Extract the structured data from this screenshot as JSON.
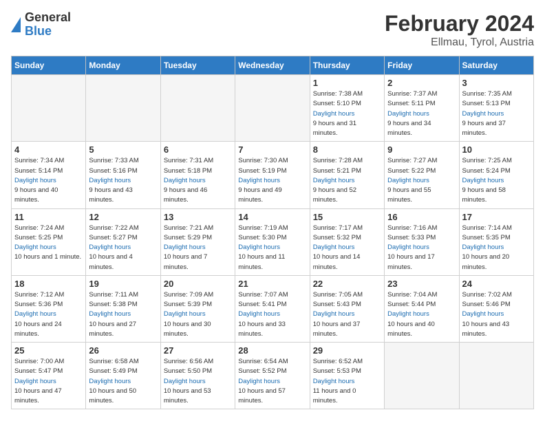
{
  "header": {
    "logo_general": "General",
    "logo_blue": "Blue",
    "month": "February 2024",
    "location": "Ellmau, Tyrol, Austria"
  },
  "days_of_week": [
    "Sunday",
    "Monday",
    "Tuesday",
    "Wednesday",
    "Thursday",
    "Friday",
    "Saturday"
  ],
  "weeks": [
    [
      {
        "day": "",
        "empty": true
      },
      {
        "day": "",
        "empty": true
      },
      {
        "day": "",
        "empty": true
      },
      {
        "day": "",
        "empty": true
      },
      {
        "day": "1",
        "sunrise": "7:38 AM",
        "sunset": "5:10 PM",
        "daylight": "9 hours and 31 minutes."
      },
      {
        "day": "2",
        "sunrise": "7:37 AM",
        "sunset": "5:11 PM",
        "daylight": "9 hours and 34 minutes."
      },
      {
        "day": "3",
        "sunrise": "7:35 AM",
        "sunset": "5:13 PM",
        "daylight": "9 hours and 37 minutes."
      }
    ],
    [
      {
        "day": "4",
        "sunrise": "7:34 AM",
        "sunset": "5:14 PM",
        "daylight": "9 hours and 40 minutes."
      },
      {
        "day": "5",
        "sunrise": "7:33 AM",
        "sunset": "5:16 PM",
        "daylight": "9 hours and 43 minutes."
      },
      {
        "day": "6",
        "sunrise": "7:31 AM",
        "sunset": "5:18 PM",
        "daylight": "9 hours and 46 minutes."
      },
      {
        "day": "7",
        "sunrise": "7:30 AM",
        "sunset": "5:19 PM",
        "daylight": "9 hours and 49 minutes."
      },
      {
        "day": "8",
        "sunrise": "7:28 AM",
        "sunset": "5:21 PM",
        "daylight": "9 hours and 52 minutes."
      },
      {
        "day": "9",
        "sunrise": "7:27 AM",
        "sunset": "5:22 PM",
        "daylight": "9 hours and 55 minutes."
      },
      {
        "day": "10",
        "sunrise": "7:25 AM",
        "sunset": "5:24 PM",
        "daylight": "9 hours and 58 minutes."
      }
    ],
    [
      {
        "day": "11",
        "sunrise": "7:24 AM",
        "sunset": "5:25 PM",
        "daylight": "10 hours and 1 minute."
      },
      {
        "day": "12",
        "sunrise": "7:22 AM",
        "sunset": "5:27 PM",
        "daylight": "10 hours and 4 minutes."
      },
      {
        "day": "13",
        "sunrise": "7:21 AM",
        "sunset": "5:29 PM",
        "daylight": "10 hours and 7 minutes."
      },
      {
        "day": "14",
        "sunrise": "7:19 AM",
        "sunset": "5:30 PM",
        "daylight": "10 hours and 11 minutes."
      },
      {
        "day": "15",
        "sunrise": "7:17 AM",
        "sunset": "5:32 PM",
        "daylight": "10 hours and 14 minutes."
      },
      {
        "day": "16",
        "sunrise": "7:16 AM",
        "sunset": "5:33 PM",
        "daylight": "10 hours and 17 minutes."
      },
      {
        "day": "17",
        "sunrise": "7:14 AM",
        "sunset": "5:35 PM",
        "daylight": "10 hours and 20 minutes."
      }
    ],
    [
      {
        "day": "18",
        "sunrise": "7:12 AM",
        "sunset": "5:36 PM",
        "daylight": "10 hours and 24 minutes."
      },
      {
        "day": "19",
        "sunrise": "7:11 AM",
        "sunset": "5:38 PM",
        "daylight": "10 hours and 27 minutes."
      },
      {
        "day": "20",
        "sunrise": "7:09 AM",
        "sunset": "5:39 PM",
        "daylight": "10 hours and 30 minutes."
      },
      {
        "day": "21",
        "sunrise": "7:07 AM",
        "sunset": "5:41 PM",
        "daylight": "10 hours and 33 minutes."
      },
      {
        "day": "22",
        "sunrise": "7:05 AM",
        "sunset": "5:43 PM",
        "daylight": "10 hours and 37 minutes."
      },
      {
        "day": "23",
        "sunrise": "7:04 AM",
        "sunset": "5:44 PM",
        "daylight": "10 hours and 40 minutes."
      },
      {
        "day": "24",
        "sunrise": "7:02 AM",
        "sunset": "5:46 PM",
        "daylight": "10 hours and 43 minutes."
      }
    ],
    [
      {
        "day": "25",
        "sunrise": "7:00 AM",
        "sunset": "5:47 PM",
        "daylight": "10 hours and 47 minutes."
      },
      {
        "day": "26",
        "sunrise": "6:58 AM",
        "sunset": "5:49 PM",
        "daylight": "10 hours and 50 minutes."
      },
      {
        "day": "27",
        "sunrise": "6:56 AM",
        "sunset": "5:50 PM",
        "daylight": "10 hours and 53 minutes."
      },
      {
        "day": "28",
        "sunrise": "6:54 AM",
        "sunset": "5:52 PM",
        "daylight": "10 hours and 57 minutes."
      },
      {
        "day": "29",
        "sunrise": "6:52 AM",
        "sunset": "5:53 PM",
        "daylight": "11 hours and 0 minutes."
      },
      {
        "day": "",
        "empty": true
      },
      {
        "day": "",
        "empty": true
      }
    ]
  ]
}
